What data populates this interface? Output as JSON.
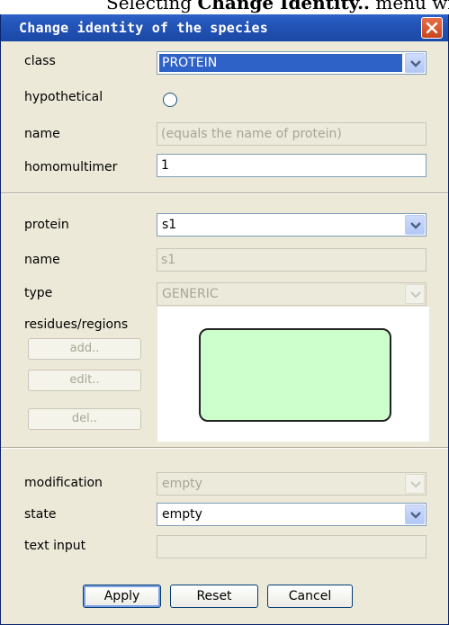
{
  "page_header": {
    "prefix": "Selecting ",
    "bold": "Change Identity..",
    "suffix": " menu will"
  },
  "dialog": {
    "title": "Change identity of the species"
  },
  "section1": {
    "class_label": "class",
    "class_value": "PROTEIN",
    "hypothetical_label": "hypothetical",
    "name_label": "name",
    "name_placeholder": "(equals the name of protein)",
    "homomultimer_label": "homomultimer",
    "homomultimer_value": "1"
  },
  "section2": {
    "protein_label": "protein",
    "protein_value": "s1",
    "name_label": "name",
    "name_value": "s1",
    "type_label": "type",
    "type_value": "GENERIC",
    "residues_label": "residues/regions",
    "add_label": "add..",
    "edit_label": "edit..",
    "del_label": "del.."
  },
  "section3": {
    "modification_label": "modification",
    "modification_value": "empty",
    "state_label": "state",
    "state_value": "empty",
    "text_input_label": "text input",
    "text_input_value": ""
  },
  "buttons": {
    "apply": "Apply",
    "reset": "Reset",
    "cancel": "Cancel"
  },
  "colors": {
    "titlebar": "#2354b6",
    "close_button": "#d9542a",
    "selection": "#2f62c7",
    "shape_fill": "#ccffcc",
    "dialog_bg": "#ece9d8"
  },
  "icons": {
    "close": "close-icon",
    "dropdown": "chevron-down-icon"
  }
}
